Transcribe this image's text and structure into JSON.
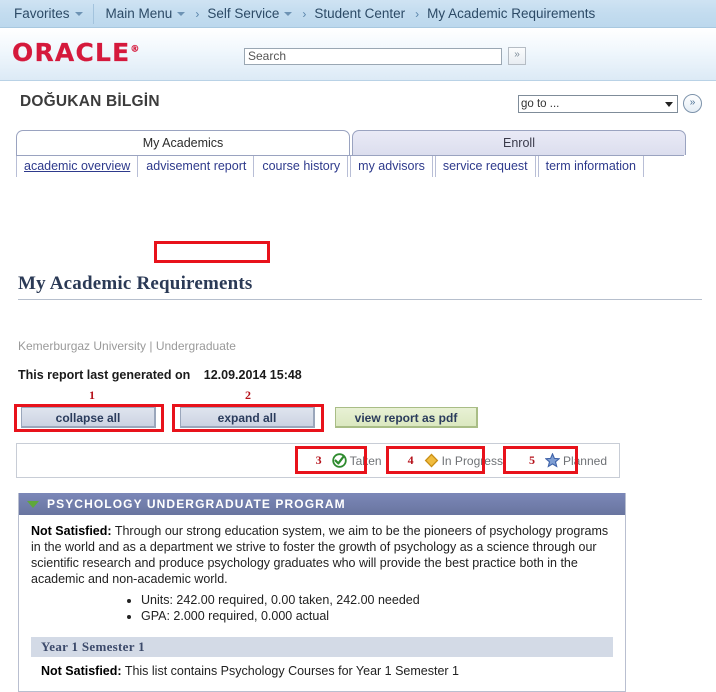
{
  "topnav": {
    "favorites": "Favorites",
    "main_menu": "Main Menu",
    "breadcrumbs": [
      "Self Service",
      "Student Center",
      "My Academic Requirements"
    ]
  },
  "branding": {
    "logo_text": "ORACLE",
    "logo_color": "#d5193c"
  },
  "search": {
    "placeholder": "Search",
    "value": "",
    "go_glyph": "»"
  },
  "header": {
    "student_name": "DOĞUKAN BİLGİN",
    "goto_label": "go to ...",
    "goto_go_glyph": "»"
  },
  "tabs": [
    {
      "label": "My Academics",
      "active": true
    },
    {
      "label": "Enroll",
      "active": false
    }
  ],
  "subtabs": [
    {
      "label": "academic overview",
      "current": true,
      "highlighted": false
    },
    {
      "label": "advisement report",
      "current": false,
      "highlighted": true
    },
    {
      "label": "course history",
      "current": false,
      "highlighted": false
    },
    {
      "label": "my advisors",
      "current": false,
      "highlighted": false
    },
    {
      "label": "service request",
      "current": false,
      "highlighted": false
    },
    {
      "label": "term information",
      "current": false,
      "highlighted": false
    }
  ],
  "main": {
    "page_title": "My Academic Requirements",
    "org_line": "Kemerburgaz University | Undergraduate",
    "report_date_label": "This report last generated on",
    "report_date_value": "12.09.2014 15:48"
  },
  "buttons": {
    "collapse_all": "collapse all",
    "expand_all": "expand all",
    "view_pdf": "view report as pdf"
  },
  "legend": [
    {
      "label": "Taken",
      "icon": "green-check-circle-icon",
      "color": "#3f9c35"
    },
    {
      "label": "In Progress",
      "icon": "gold-diamond-icon",
      "color": "#e8a320"
    },
    {
      "label": "Planned",
      "icon": "blue-star-icon",
      "color": "#5b7fc0"
    }
  ],
  "annotations": {
    "numbers": [
      "1",
      "2",
      "3",
      "4",
      "5"
    ],
    "color": "#e8121b"
  },
  "program": {
    "title": "PSYCHOLOGY UNDERGRADUATE PROGRAM",
    "status_label": "Not Satisfied:",
    "description": "Through our strong education system, we aim to be the pioneers of psychology programs in the world and as a department we strive to foster the growth of psychology as a science through our scientific research and produce psychology graduates who will provide the best practice both in the academic and non-academic world.",
    "requirements": [
      "Units: 242.00 required, 0.00 taken, 242.00 needed",
      "GPA: 2.000 required, 0.000 actual"
    ],
    "subsection": {
      "title": "Year 1 Semester 1",
      "status_label": "Not Satisfied:",
      "description": "This list contains Psychology Courses for Year 1 Semester 1"
    }
  }
}
